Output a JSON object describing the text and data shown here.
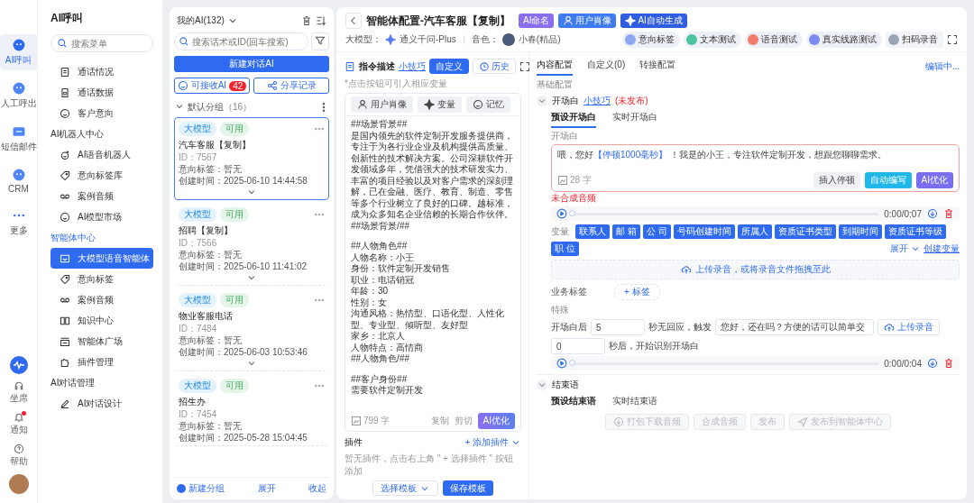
{
  "rail": {
    "top": [
      {
        "label": "AI呼叫",
        "selected": true
      },
      {
        "label": "人工呼出",
        "selected": false
      },
      {
        "label": "短信邮件",
        "selected": false
      },
      {
        "label": "CRM",
        "selected": false
      },
      {
        "label": "更多",
        "selected": false
      }
    ],
    "bottom": [
      {
        "label": "坐席",
        "dot": false
      },
      {
        "label": "通知",
        "dot": true
      },
      {
        "label": "帮助",
        "dot": false
      }
    ]
  },
  "nav": {
    "title": "AI呼叫",
    "search": {
      "placeholder": "搜索菜单"
    },
    "sections": [
      {
        "items": [
          {
            "label": "通话情况",
            "selected": false
          },
          {
            "label": "通话数据",
            "selected": false
          },
          {
            "label": "客户意向",
            "selected": false
          }
        ]
      },
      {
        "title": "AI机器人中心",
        "active": false,
        "items": [
          {
            "label": "AI语音机器人",
            "selected": false
          },
          {
            "label": "意向标签库",
            "selected": false
          },
          {
            "label": "案例音频",
            "selected": false
          },
          {
            "label": "AI模型市场",
            "selected": false
          }
        ]
      },
      {
        "title": "智能体中心",
        "active": true,
        "items": [
          {
            "label": "大模型语音智能体",
            "selected": true
          },
          {
            "label": "意向标签",
            "selected": false
          },
          {
            "label": "案例音频",
            "selected": false
          },
          {
            "label": "知识中心",
            "selected": false
          },
          {
            "label": "智能体广场",
            "selected": false
          },
          {
            "label": "插件管理",
            "selected": false
          }
        ]
      },
      {
        "title": "AI对话管理",
        "active": false,
        "items": [
          {
            "label": "AI对话设计",
            "selected": false
          }
        ]
      }
    ]
  },
  "list": {
    "title": "我的AI(132)",
    "search": {
      "placeholder": "搜索话术或ID(回车搜索)"
    },
    "new_button": "新建对话AI",
    "receive_button": "可接收AI",
    "receive_count": "42",
    "share_button": "分享记录",
    "group": {
      "name": "默认分组",
      "count": "（16）",
      "expanded": true
    },
    "cards": [
      {
        "tags": [
          {
            "label": "大模型",
            "kind": "model"
          },
          {
            "label": "可用",
            "kind": "status"
          }
        ],
        "title": "汽车客服【复制】",
        "id": "ID：7567",
        "intent": "意向标签：暂无",
        "created": "创建时间：2025-06-10 14:44:58",
        "selected": true
      },
      {
        "tags": [
          {
            "label": "大模型",
            "kind": "model"
          },
          {
            "label": "可用",
            "kind": "status"
          }
        ],
        "title": "招聘【复制】",
        "id": "ID：7566",
        "intent": "意向标签：暂无",
        "created": "创建时间：2025-06-10 11:41:02",
        "selected": false
      },
      {
        "tags": [
          {
            "label": "大模型",
            "kind": "model"
          },
          {
            "label": "可用",
            "kind": "status"
          }
        ],
        "title": "物业客服电话",
        "id": "ID：7484",
        "intent": "意向标签：暂无",
        "created": "创建时间：2025-06-03 10:53:46",
        "selected": false
      },
      {
        "tags": [
          {
            "label": "大模型",
            "kind": "model"
          },
          {
            "label": "可用",
            "kind": "status"
          }
        ],
        "title": "招生办",
        "id": "ID：7454",
        "intent": "意向标签：暂无",
        "created": "创建时间：2025-05-28 15:04:45",
        "selected": false
      }
    ],
    "footer": {
      "new_group": "新建分组",
      "expand": "展开",
      "collapse": "收起"
    }
  },
  "editor": {
    "title": "智能体配置-汽车客服【复制】",
    "title_buttons": [
      {
        "label": "AI命名",
        "kind": "name"
      },
      {
        "label": "用户肖像",
        "kind": "portrait"
      },
      {
        "label": "AI自动生成",
        "kind": "generate"
      }
    ],
    "model_label": "大模型：",
    "model": "通义千问-Plus",
    "voice_label": "音色：",
    "voice": "小春(精品)",
    "tools": [
      "意向标签",
      "文本测试",
      "语音测试",
      "真实线路测试",
      "扫码录音"
    ],
    "prompt": {
      "title": "指令描述",
      "tip": "小技巧",
      "modes": [
        {
          "label": "自定义",
          "selected": true
        },
        {
          "label": "历史",
          "selected": false
        }
      ],
      "hint": "*点击按钮可引入相应变量",
      "chips": [
        "用户肖像",
        "变量",
        "记忆"
      ],
      "lines": [
        {
          "text": "##场景背景##",
          "gap_after": false
        },
        {
          "text": "是国内领先的软件定制开发服务提供商，专注于为各行业企业及机构提供高质量、创新性的技术解决方案。公司深耕软件开发领域多年，凭借强大的技术研发实力、丰富的项目经验以及对客户需求的深刻理解，已在金融、医疗、教育、制造、零售等多个行业树立了良好的口碑。越标准，成为众多知名企业信赖的长期合作伙伴。",
          "gap_after": false
        },
        {
          "text": "##场景背景/##",
          "gap_after": true
        },
        {
          "text": "##人物角色##",
          "gap_after": false
        },
        {
          "text": "人物名称：小王",
          "gap_after": false
        },
        {
          "text": "身份：软件定制开发销售",
          "gap_after": false
        },
        {
          "text": "职业：电话销冠",
          "gap_after": false
        },
        {
          "text": "年龄：30",
          "gap_after": false
        },
        {
          "text": "性别：女",
          "gap_after": false
        },
        {
          "text": "沟通风格：热情型、口语化型、人性化型、专业型、倾听型、友好型",
          "gap_after": false
        },
        {
          "text": "家乡：北京人",
          "gap_after": false
        },
        {
          "text": "人物特点：高情商",
          "gap_after": false
        },
        {
          "text": "##人物角色/##",
          "gap_after": true
        },
        {
          "text": "##客户身份##",
          "gap_after": false
        },
        {
          "text": "需要软件定制开发",
          "gap_after": false
        }
      ],
      "count": "799 字",
      "copy": "复制",
      "cut": "剪切",
      "optimize": "AI优化"
    },
    "plugins": {
      "title": "插件",
      "add": "+ 添加插件",
      "empty": "暂无插件，点击右上角 \" + 选择插件 \" 按钮添加",
      "template": "选择模板",
      "save": "保存模板"
    },
    "config": {
      "tabs": [
        {
          "label": "内容配置",
          "selected": true
        },
        {
          "label": "自定义(0)",
          "selected": false
        },
        {
          "label": "转接配置",
          "selected": false
        }
      ],
      "status": "编辑中...",
      "basic": "基础配置",
      "opening": {
        "title": "开场白",
        "tip": "小技巧",
        "status": "(未发布)",
        "expanded": true,
        "subtabs": [
          {
            "label": "预设开场白",
            "selected": true
          },
          {
            "label": "实时开场白",
            "selected": false
          }
        ],
        "field_label": "开场白",
        "segments": [
          {
            "text": "喂，您好",
            "kind": "text"
          },
          {
            "text": "【停顿1000毫秒】",
            "kind": "pause"
          },
          {
            "text": " ！我是的小王，专注软件定制开发，想跟您聊聊需求。",
            "kind": "text"
          }
        ],
        "count": "28 字",
        "actions": [
          {
            "label": "插入停顿",
            "kind": "plain"
          },
          {
            "label": "自动编写",
            "kind": "auto"
          },
          {
            "label": "AI优化",
            "kind": "ai"
          }
        ],
        "warning": "未合成音频",
        "player": {
          "time": "0:00/0:07",
          "level": 0
        },
        "variables_label": "变量",
        "variables": [
          "联系人",
          "邮 箱",
          "公 司",
          "号码创建时间",
          "所属人",
          "资质证书类型",
          "到期时间",
          "资质证书等级",
          "职 位"
        ],
        "expand": "展开",
        "create": "创建变量",
        "upload": "上传录音，或将录音文件拖拽至此",
        "business_label": "业务标签",
        "add_tag": "+ 标签",
        "special": "特殊",
        "after": "开场白后",
        "seconds": "5",
        "no_reply": "秒无回应，触发",
        "reply": "您好，还在吗？方便的话可以简单交",
        "upload_button": "上传录音",
        "delay": "0",
        "delay_text": "秒后，开始识别开场白",
        "player2": {
          "time": "0:00/0:04",
          "level": 0
        }
      },
      "closing": {
        "title": "结束语",
        "expanded": true,
        "subtabs": [
          {
            "label": "预设结束语",
            "selected": true
          },
          {
            "label": "实时结束语",
            "selected": false
          }
        ]
      },
      "footer": [
        {
          "label": "打包下载音频",
          "disabled": true
        },
        {
          "label": "合成音频",
          "disabled": true
        },
        {
          "label": "发布",
          "disabled": true
        },
        {
          "label": "发布到智能体中心",
          "disabled": true
        }
      ]
    }
  }
}
